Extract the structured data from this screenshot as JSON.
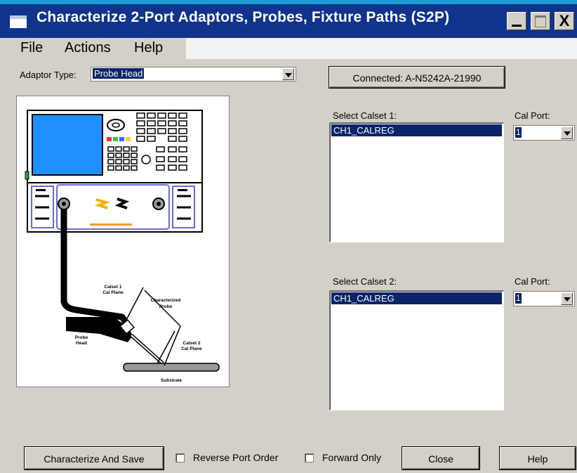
{
  "window": {
    "title": "Characterize 2-Port Adaptors, Probes, Fixture Paths (S2P)",
    "minimize_glyph": "",
    "close_glyph": "X"
  },
  "menu": [
    "File",
    "Actions",
    "Help"
  ],
  "adaptor": {
    "label": "Adaptor Type:",
    "value": "Probe Head"
  },
  "connected_label": "Connected: A-N5242A-21990",
  "diagram": {
    "labels": {
      "calset1": [
        "Calset 1",
        "Cal Plane"
      ],
      "characterized": [
        "Characterized",
        "Probe"
      ],
      "probe_head": [
        "Probe",
        "Head"
      ],
      "calset2": [
        "Calset 2",
        "Cal Plane"
      ],
      "substrate": "Substrate"
    }
  },
  "calset1": {
    "label": "Select Calset 1:",
    "items": [
      "CH1_CALREG"
    ],
    "port_label": "Cal Port:",
    "port_value": "1"
  },
  "calset2": {
    "label": "Select Calset 2:",
    "items": [
      "CH1_CALREG"
    ],
    "port_label": "Cal Port:",
    "port_value": "1"
  },
  "footer": {
    "characterize_label": "Characterize And Save",
    "reverse_label": "Reverse Port Order",
    "reverse_checked": false,
    "forward_label": "Forward Only",
    "forward_checked": false,
    "close_label": "Close",
    "help_label": "Help"
  }
}
